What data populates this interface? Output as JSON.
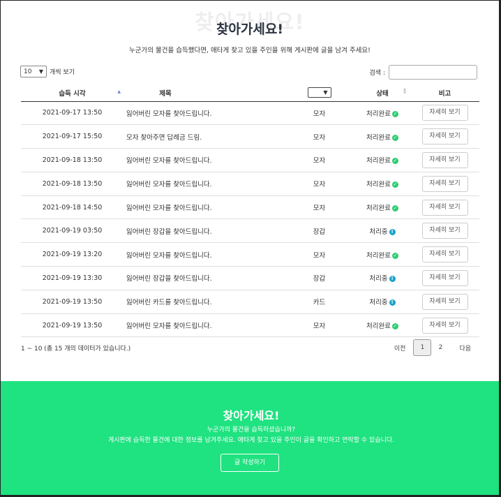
{
  "hero": {
    "ghost": "찾아가세요!",
    "title": "찾아가세요!",
    "subtitle": "누군가의 물건을 습득했다면, 애타게 찾고 있을 주인을 위해 게시판에 글을 남겨 주세요!"
  },
  "controls": {
    "page_length": "10",
    "page_length_suffix": "개씩 보기",
    "search_label": "검색 :",
    "search_value": ""
  },
  "table": {
    "headers": {
      "time": "습득 시각",
      "title": "제목",
      "status": "상태",
      "note": "비고"
    },
    "rows": [
      {
        "time": "2021-09-17 13:50",
        "title": "잃어버린 모자를 찾아드립니다.",
        "category": "모자",
        "status": "처리완료",
        "status_type": "done",
        "action": "자세히 보기"
      },
      {
        "time": "2021-09-17 15:50",
        "title": "모자 찾아주면 답례금 드림.",
        "category": "모자",
        "status": "처리완료",
        "status_type": "done",
        "action": "자세히 보기"
      },
      {
        "time": "2021-09-18 13:50",
        "title": "잃어버린 모자를 찾아드립니다.",
        "category": "모자",
        "status": "처리완료",
        "status_type": "done",
        "action": "자세히 보기"
      },
      {
        "time": "2021-09-18 13:50",
        "title": "잃어버린 모자를 찾아드립니다.",
        "category": "모자",
        "status": "처리완료",
        "status_type": "done",
        "action": "자세히 보기"
      },
      {
        "time": "2021-09-18 14:50",
        "title": "잃어버린 모자를 찾아드립니다.",
        "category": "모자",
        "status": "처리완료",
        "status_type": "done",
        "action": "자세히 보기"
      },
      {
        "time": "2021-09-19 03:50",
        "title": "잃어버린 장갑을 찾아드립니다.",
        "category": "장갑",
        "status": "처리중",
        "status_type": "progress",
        "action": "자세히 보기"
      },
      {
        "time": "2021-09-19 13:20",
        "title": "잃어버린 모자를 찾아드립니다.",
        "category": "모자",
        "status": "처리완료",
        "status_type": "done",
        "action": "자세히 보기"
      },
      {
        "time": "2021-09-19 13:30",
        "title": "잃어버린 장갑을 찾아드립니다.",
        "category": "장갑",
        "status": "처리중",
        "status_type": "progress",
        "action": "자세히 보기"
      },
      {
        "time": "2021-09-19 13:50",
        "title": "잃어버린 카드를 찾아드립니다.",
        "category": "카드",
        "status": "처리중",
        "status_type": "progress",
        "action": "자세히 보기"
      },
      {
        "time": "2021-09-19 13:50",
        "title": "잃어버린 모자를 찾아드립니다.",
        "category": "모자",
        "status": "처리완료",
        "status_type": "done",
        "action": "자세히 보기"
      }
    ]
  },
  "footer": {
    "info": "1 ~ 10 (총 15 개의 데이터가 있습니다.)",
    "prev": "이전",
    "pages": [
      "1",
      "2"
    ],
    "next": "다음"
  },
  "banner": {
    "title": "찾아가세요!",
    "line1": "누군가의 물건을 습득하셨습니까?",
    "line2": "게시판에 습득한 물건에 대한 정보를 남겨주세요. 애타게 찾고 있을 주인이 글을 확인하고 연락할 수 있습니다.",
    "button": "글 작성하기"
  },
  "colors": {
    "done": "#2ecc71",
    "progress": "#17a2c8",
    "banner": "#1fe280"
  },
  "icons": {
    "done": "check-circle-icon",
    "progress": "info-circle-icon"
  }
}
